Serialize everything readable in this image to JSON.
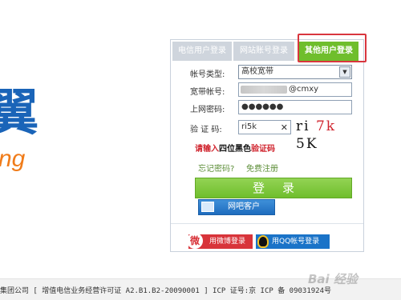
{
  "brand": {
    "char": "翼",
    "sub": "ng"
  },
  "tabs": [
    {
      "label": "电信用户登录"
    },
    {
      "label": "网站账号登录"
    },
    {
      "label": "其他用户登录"
    }
  ],
  "form": {
    "account_type": {
      "label": "帐号类型:",
      "value": "高校宽带"
    },
    "broadband_account": {
      "label": "宽带帐号:",
      "suffix": "@cmxy"
    },
    "password": {
      "label": "上网密码:",
      "value": "●●●●●●"
    },
    "captcha": {
      "label": "验 证 码:",
      "value": "ri5k",
      "clear": "✕",
      "image_text_1": "ri",
      "image_text_2": "7k",
      "image_text_3": "5K"
    }
  },
  "hint": {
    "part1": "请输入",
    "part2": "四位",
    "part3": "黑色",
    "part4": "验证码"
  },
  "links": {
    "forgot": "忘记密码?",
    "register": "免费注册"
  },
  "buttons": {
    "login": "登录",
    "client": "网吧客户",
    "weibo": "用微博登录",
    "qq": "用QQ帐号登录"
  },
  "footer": {
    "text": "集团公司 [ 增值电信业务经营许可证 A2.B1.B2-20090001 ] ICP 证号:京 ICP 备 09031924号"
  },
  "watermark": "Bai 经验",
  "colors": {
    "accent_green": "#6fbe2c",
    "highlight_red": "#d9363e",
    "brand_blue": "#1a64b8",
    "brand_orange": "#f07c1a"
  }
}
